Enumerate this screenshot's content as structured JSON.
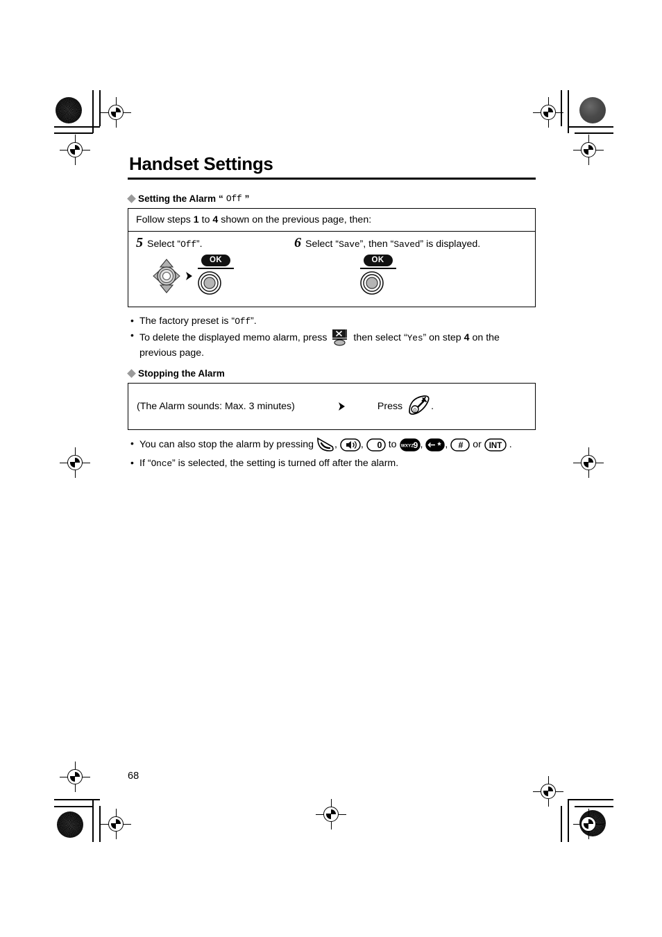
{
  "page": {
    "title": "Handset Settings",
    "number": "68"
  },
  "section_alarm_off": {
    "heading_prefix": "Setting the Alarm ",
    "heading_value": "“Off”",
    "heading_quote_open": "“",
    "heading_quote_close": "”",
    "heading_mono": "Off",
    "panel_head_part1": "Follow steps ",
    "panel_head_num1": "1",
    "panel_head_part2": " to ",
    "panel_head_num2": "4",
    "panel_head_part3": " shown on the previous page, then:",
    "steps": [
      {
        "number": "5",
        "text_pre": "Select “",
        "text_mono": "Off",
        "text_post": "”.",
        "icons": [
          "navigator-key",
          "right-arrow",
          "ok-key"
        ]
      },
      {
        "number": "6",
        "text_pre": "Select “",
        "text_mono": "Save",
        "text_mid": "”, then “",
        "text_mono2": "Saved",
        "text_post": "” is displayed.",
        "icons": [
          "ok-key"
        ]
      }
    ],
    "ok_label": "OK",
    "bullets": [
      {
        "pre": "The factory preset is “",
        "mono": "Off",
        "post": "”."
      },
      {
        "pre": "To delete the displayed memo alarm, press ",
        "icon": "erase-key",
        "mid": " then select “",
        "mono": "Yes",
        "mid2": "” on step ",
        "bold": "4",
        "post": " on the previous page."
      }
    ]
  },
  "section_stopping": {
    "heading": "Stopping the Alarm",
    "panel_left": "(The Alarm sounds: Max. 3 minutes)",
    "panel_press": "Press",
    "panel_press_icon": "off-hook-key",
    "panel_period": ".",
    "bullets": [
      {
        "pre": "You can also stop the alarm by pressing ",
        "keys": [
          "talk-key",
          "speakerphone-key",
          "digit-0-key"
        ],
        "to": " to ",
        "keys2": [
          "digit-9-key",
          "star-key",
          "hash-key"
        ],
        "or": " or ",
        "keys3": [
          "int-key"
        ],
        "post": " ."
      },
      {
        "pre": "If “",
        "mono": "Once",
        "post": "” is selected, the setting is turned off after the alarm."
      }
    ],
    "key_labels": {
      "digit_0": "0",
      "digit_9": "9",
      "digit_9_letters": "WXYZ",
      "star": "*",
      "hash": "#",
      "int": "INT"
    }
  },
  "print_marks": {
    "registration": "registration-target",
    "color_patch": "color-calibration-dot"
  }
}
